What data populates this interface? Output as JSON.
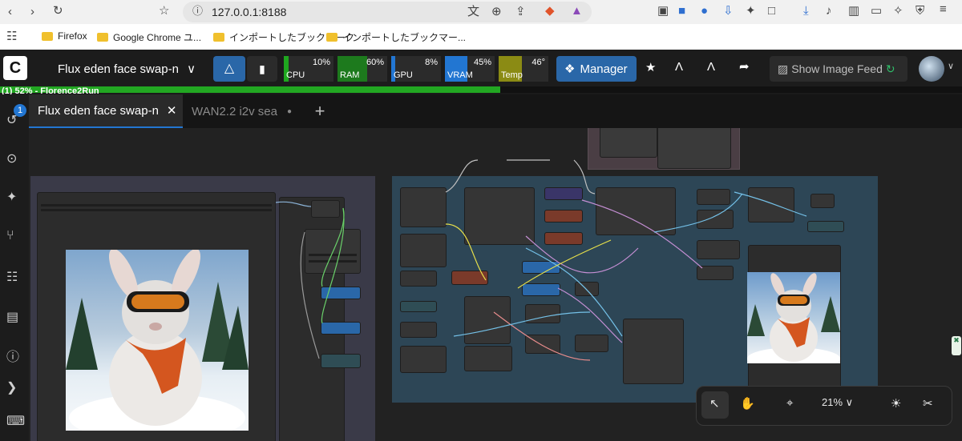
{
  "browser": {
    "url": "127.0.0.1:8188",
    "bookmarks": [
      {
        "label": "Firefox"
      },
      {
        "label": "Google Chrome ユ..."
      },
      {
        "label": "インポートしたブックマーク"
      },
      {
        "label": "インポートしたブックマー..."
      }
    ]
  },
  "comfy": {
    "workflow_title": "Flux eden face swap-n",
    "manager_label": "Manager",
    "show_image_feed_label": "Show Image Feed",
    "meters": [
      {
        "label": "CPU",
        "value": "10%",
        "fill": 0.1,
        "color": "#1fa71f"
      },
      {
        "label": "RAM",
        "value": "60%",
        "fill": 0.6,
        "color": "#1d7a1d"
      },
      {
        "label": "GPU",
        "value": "8%",
        "fill": 0.08,
        "color": "#2276d2"
      },
      {
        "label": "VRAM",
        "value": "45%",
        "fill": 0.45,
        "color": "#2276d2"
      },
      {
        "label": "Temp",
        "value": "46°",
        "fill": 0.46,
        "color": "#8b8b14"
      }
    ],
    "progress": {
      "text": "(1) 52% - Florence2Run",
      "fraction": 0.52
    },
    "queue_badge": "1"
  },
  "tabs": [
    {
      "label": "Flux eden face swap-n",
      "active": true
    },
    {
      "label": "WAN2.2 i2v sea",
      "active": false
    }
  ],
  "toolbar": {
    "zoom_label": "21%"
  },
  "colors": {
    "accent": "#2276d2",
    "progress": "#22a722",
    "group_left": "#3a3a4a",
    "group_right": "#2d4656"
  }
}
